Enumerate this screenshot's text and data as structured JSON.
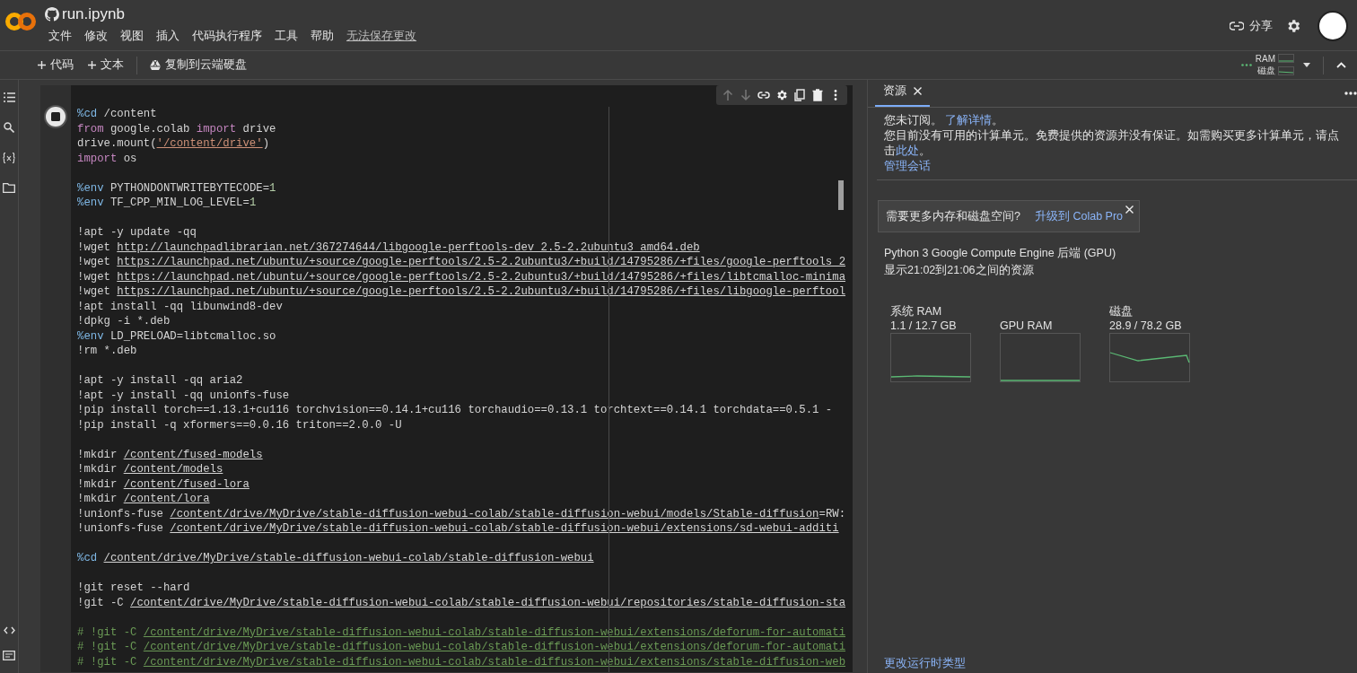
{
  "app": {
    "title": "run.ipynb"
  },
  "menu": [
    {
      "label": "文件"
    },
    {
      "label": "修改"
    },
    {
      "label": "视图"
    },
    {
      "label": "插入"
    },
    {
      "label": "代码执行程序"
    },
    {
      "label": "工具"
    },
    {
      "label": "帮助"
    }
  ],
  "save_status": "无法保存更改",
  "header_actions": {
    "share": "分享"
  },
  "toolbar": {
    "buttons": [
      {
        "label": "代码",
        "kind": "add"
      },
      {
        "label": "文本",
        "kind": "add"
      },
      {
        "label": "复制到云端硬盘",
        "kind": "drive"
      }
    ],
    "indicator": [
      "RAM",
      "磁盘"
    ]
  },
  "cell": {
    "running": true,
    "lines": [
      {
        "gap": false,
        "segments": [
          {
            "text": "%cd",
            "kind": "magic"
          },
          {
            "text": " /content",
            "kind": "plain"
          }
        ]
      },
      {
        "gap": false,
        "segments": [
          {
            "text": "from",
            "kind": "keyword"
          },
          {
            "text": " google.colab ",
            "kind": "plain"
          },
          {
            "text": "import",
            "kind": "keyword"
          },
          {
            "text": " drive",
            "kind": "plain"
          }
        ]
      },
      {
        "gap": false,
        "segments": [
          {
            "text": "drive.mount(",
            "kind": "plain"
          },
          {
            "text": "'/content/drive'",
            "kind": "string"
          },
          {
            "text": ")",
            "kind": "plain"
          }
        ]
      },
      {
        "gap": false,
        "segments": [
          {
            "text": "import",
            "kind": "keyword"
          },
          {
            "text": " os",
            "kind": "plain"
          }
        ]
      },
      {
        "gap": true,
        "segments": [
          {
            "text": "%env",
            "kind": "magic"
          },
          {
            "text": " PYTHONDONTWRITEBYTECODE=",
            "kind": "plain"
          },
          {
            "text": "1",
            "kind": "number"
          }
        ]
      },
      {
        "gap": false,
        "segments": [
          {
            "text": "%env",
            "kind": "magic"
          },
          {
            "text": " TF_CPP_MIN_LOG_LEVEL=",
            "kind": "plain"
          },
          {
            "text": "1",
            "kind": "number"
          }
        ]
      },
      {
        "gap": true,
        "segments": [
          {
            "text": "!apt -y update -qq",
            "kind": "plain"
          }
        ]
      },
      {
        "gap": false,
        "segments": [
          {
            "text": "!wget ",
            "kind": "plain"
          },
          {
            "text": "http://launchpadlibrarian.net/367274644/libgoogle-perftools-dev_2.5-2.2ubuntu3_amd64.deb",
            "kind": "path"
          }
        ]
      },
      {
        "gap": false,
        "segments": [
          {
            "text": "!wget ",
            "kind": "plain"
          },
          {
            "text": "https://launchpad.net/ubuntu/+source/google-perftools/2.5-2.2ubuntu3/+build/14795286/+files/google-perftools_2",
            "kind": "path"
          }
        ]
      },
      {
        "gap": false,
        "segments": [
          {
            "text": "!wget ",
            "kind": "plain"
          },
          {
            "text": "https://launchpad.net/ubuntu/+source/google-perftools/2.5-2.2ubuntu3/+build/14795286/+files/libtcmalloc-minima",
            "kind": "path"
          }
        ]
      },
      {
        "gap": false,
        "segments": [
          {
            "text": "!wget ",
            "kind": "plain"
          },
          {
            "text": "https://launchpad.net/ubuntu/+source/google-perftools/2.5-2.2ubuntu3/+build/14795286/+files/libgoogle-perftool",
            "kind": "path"
          }
        ]
      },
      {
        "gap": false,
        "segments": [
          {
            "text": "!apt install -qq libunwind8-dev",
            "kind": "plain"
          }
        ]
      },
      {
        "gap": false,
        "segments": [
          {
            "text": "!dpkg -i *.deb",
            "kind": "plain"
          }
        ]
      },
      {
        "gap": false,
        "segments": [
          {
            "text": "%env",
            "kind": "magic"
          },
          {
            "text": " LD_PRELOAD=libtcmalloc.so",
            "kind": "plain"
          }
        ]
      },
      {
        "gap": false,
        "segments": [
          {
            "text": "!rm *.deb",
            "kind": "plain"
          }
        ]
      },
      {
        "gap": true,
        "segments": [
          {
            "text": "!apt -y install -qq aria2",
            "kind": "plain"
          }
        ]
      },
      {
        "gap": false,
        "segments": [
          {
            "text": "!apt -y install -qq unionfs-fuse",
            "kind": "plain"
          }
        ]
      },
      {
        "gap": false,
        "segments": [
          {
            "text": "!pip install torch==1.13.1+cu116 torchvision==0.14.1+cu116 torchaudio==0.13.1 torchtext==0.14.1 torchdata==0.5.1 -",
            "kind": "plain"
          }
        ]
      },
      {
        "gap": false,
        "segments": [
          {
            "text": "!pip install -q xformers==0.0.16 triton==2.0.0 -U",
            "kind": "plain"
          }
        ]
      },
      {
        "gap": true,
        "segments": [
          {
            "text": "!mkdir ",
            "kind": "plain"
          },
          {
            "text": "/content/fused-models",
            "kind": "path"
          }
        ]
      },
      {
        "gap": false,
        "segments": [
          {
            "text": "!mkdir ",
            "kind": "plain"
          },
          {
            "text": "/content/models",
            "kind": "path"
          }
        ]
      },
      {
        "gap": false,
        "segments": [
          {
            "text": "!mkdir ",
            "kind": "plain"
          },
          {
            "text": "/content/fused-lora",
            "kind": "path"
          }
        ]
      },
      {
        "gap": false,
        "segments": [
          {
            "text": "!mkdir ",
            "kind": "plain"
          },
          {
            "text": "/content/lora",
            "kind": "path"
          }
        ]
      },
      {
        "gap": false,
        "segments": [
          {
            "text": "!unionfs-fuse ",
            "kind": "plain"
          },
          {
            "text": "/content/drive/MyDrive/stable-diffusion-webui-colab/stable-diffusion-webui/models/Stable-diffusion",
            "kind": "path"
          },
          {
            "text": "=RW:",
            "kind": "plain"
          }
        ]
      },
      {
        "gap": false,
        "segments": [
          {
            "text": "!unionfs-fuse ",
            "kind": "plain"
          },
          {
            "text": "/content/drive/MyDrive/stable-diffusion-webui-colab/stable-diffusion-webui/extensions/sd-webui-additi",
            "kind": "path"
          }
        ]
      },
      {
        "gap": true,
        "segments": [
          {
            "text": "%cd ",
            "kind": "magic"
          },
          {
            "text": "/content/drive/MyDrive/stable-diffusion-webui-colab/stable-diffusion-webui",
            "kind": "path"
          }
        ]
      },
      {
        "gap": true,
        "segments": [
          {
            "text": "!git reset --hard",
            "kind": "plain"
          }
        ]
      },
      {
        "gap": false,
        "segments": [
          {
            "text": "!git -C ",
            "kind": "plain"
          },
          {
            "text": "/content/drive/MyDrive/stable-diffusion-webui-colab/stable-diffusion-webui/repositories/stable-diffusion-sta",
            "kind": "path"
          }
        ]
      },
      {
        "gap": true,
        "segments": [
          {
            "text": "# !git -C ",
            "kind": "comment"
          },
          {
            "text": "/content/drive/MyDrive/stable-diffusion-webui-colab/stable-diffusion-webui/extensions/deforum-for-automati",
            "kind": "comment_path"
          }
        ]
      },
      {
        "gap": false,
        "segments": [
          {
            "text": "# !git -C ",
            "kind": "comment"
          },
          {
            "text": "/content/drive/MyDrive/stable-diffusion-webui-colab/stable-diffusion-webui/extensions/deforum-for-automati",
            "kind": "comment_path"
          }
        ]
      },
      {
        "gap": false,
        "segments": [
          {
            "text": "# !git -C ",
            "kind": "comment"
          },
          {
            "text": "/content/drive/MyDrive/stable-diffusion-webui-colab/stable-diffusion-webui/extensions/stable-diffusion-web",
            "kind": "comment_path"
          }
        ]
      }
    ]
  },
  "panel": {
    "tab": {
      "label": "资源",
      "selected": true
    },
    "notice": {
      "line1": "您未订阅。",
      "learn_more": "了解详情",
      "line1_end": "。",
      "line2": "您目前没有可用的计算单元。免费提供的资源并没有保证。如需购买更多计算单元，请点击",
      "here": "此处",
      "line2_end": "。",
      "manage": "管理会话"
    },
    "banner": {
      "text": "需要更多内存和磁盘空间?",
      "link": "升级到 Colab Pro"
    },
    "runtime": "Python 3 Google Compute Engine 后端 (GPU)",
    "range": "显示21:02到21:06之间的资源",
    "meters": [
      {
        "label": "系统 RAM",
        "reading": "1.1 / 12.7 GB"
      },
      {
        "label": "GPU RAM"
      },
      {
        "label": "磁盘",
        "reading": "28.9 / 78.2 GB"
      }
    ],
    "footer_link": "更改运行时类型"
  }
}
